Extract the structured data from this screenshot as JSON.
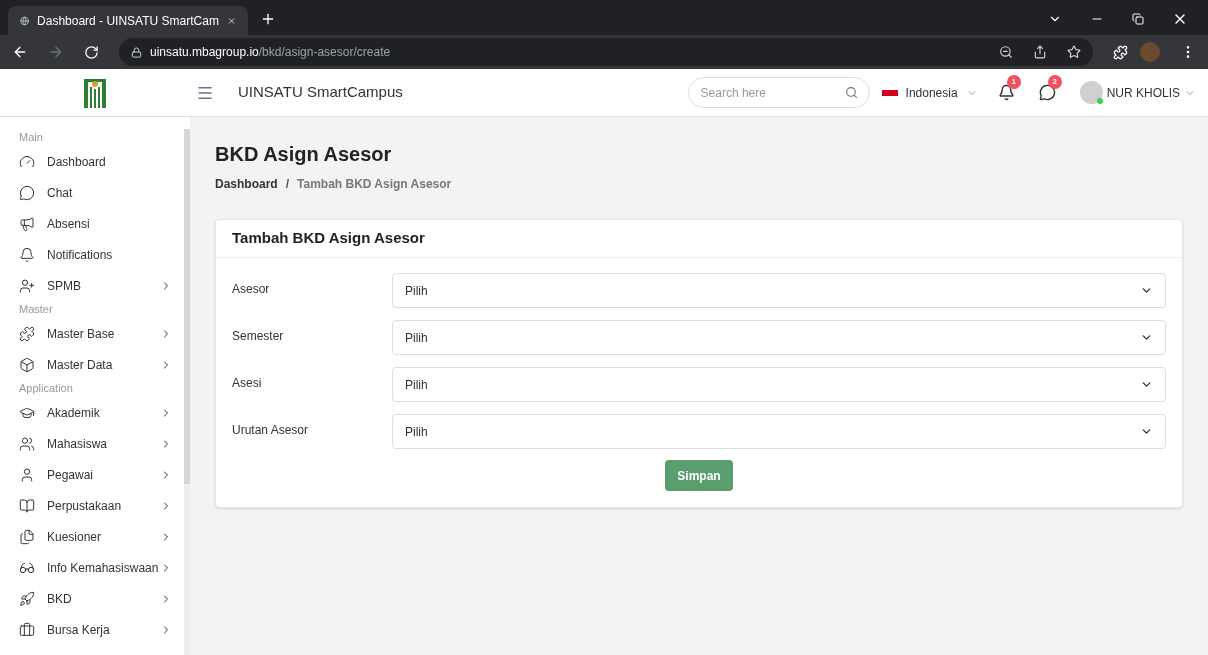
{
  "browser": {
    "tab_title": "Dashboard - UINSATU SmartCam",
    "url_host": "uinsatu.mbagroup.io",
    "url_path": "/bkd/asign-asesor/create"
  },
  "header": {
    "app_name": "UINSATU SmartCampus",
    "search": {
      "placeholder": "Search here"
    },
    "language": "Indonesia",
    "notifications_count": "1",
    "messages_count": "2",
    "user_name": "NUR KHOLIS"
  },
  "sidebar": {
    "sections": [
      {
        "title": "Main",
        "items": [
          {
            "kind": "dashboard",
            "label": "Dashboard",
            "expandable": false
          },
          {
            "kind": "chat",
            "label": "Chat",
            "expandable": false
          },
          {
            "kind": "megaphone",
            "label": "Absensi",
            "expandable": false
          },
          {
            "kind": "bell",
            "label": "Notifications",
            "expandable": false
          },
          {
            "kind": "user-plus",
            "label": "SPMB",
            "expandable": true
          }
        ]
      },
      {
        "title": "Master",
        "items": [
          {
            "kind": "puzzle",
            "label": "Master Base",
            "expandable": true
          },
          {
            "kind": "box",
            "label": "Master Data",
            "expandable": true
          }
        ]
      },
      {
        "title": "Application",
        "items": [
          {
            "kind": "cap",
            "label": "Akademik",
            "expandable": true
          },
          {
            "kind": "users",
            "label": "Mahasiswa",
            "expandable": true
          },
          {
            "kind": "user",
            "label": "Pegawai",
            "expandable": true
          },
          {
            "kind": "book",
            "label": "Perpustakaan",
            "expandable": true
          },
          {
            "kind": "copy",
            "label": "Kuesioner",
            "expandable": true
          },
          {
            "kind": "spy",
            "label": "Info Kemahasiswaan",
            "expandable": true
          },
          {
            "kind": "rocket",
            "label": "BKD",
            "expandable": true
          },
          {
            "kind": "briefcase",
            "label": "Bursa Kerja",
            "expandable": true
          }
        ]
      }
    ]
  },
  "page": {
    "title": "BKD Asign Asesor",
    "breadcrumb": [
      "Dashboard",
      "Tambah BKD Asign Asesor"
    ],
    "breadcrumb_separator": "/"
  },
  "form": {
    "title": "Tambah BKD Asign Asesor",
    "fields": [
      {
        "label": "Asesor",
        "value": "Pilih"
      },
      {
        "label": "Semester",
        "value": "Pilih"
      },
      {
        "label": "Asesi",
        "value": "Pilih"
      },
      {
        "label": "Urutan Asesor",
        "value": "Pilih"
      }
    ],
    "submit": "Simpan"
  }
}
